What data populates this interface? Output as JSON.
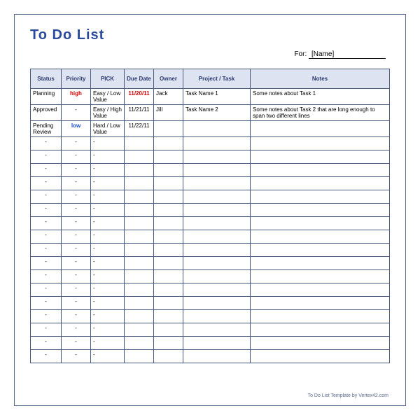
{
  "title": "To Do List",
  "for_label": "For:",
  "for_name": "[Name]",
  "headers": {
    "status": "Status",
    "priority": "Priority",
    "pick": "PICK",
    "due": "Due Date",
    "owner": "Owner",
    "task": "Project / Task",
    "notes": "Notes"
  },
  "rows": [
    {
      "status": "Planning",
      "priority": "high",
      "priority_class": "priority-high",
      "pick": "Easy / Low Value",
      "due": "11/20/11",
      "due_class": "due-red",
      "owner": "Jack",
      "task": "Task Name 1",
      "notes": "Some notes about Task 1"
    },
    {
      "status": "Approved",
      "priority": "-",
      "priority_class": "center",
      "pick": "Easy / High Value",
      "due": "11/21/11",
      "due_class": "center",
      "owner": "Jill",
      "task": "Task Name 2",
      "notes": "Some notes about Task 2 that are long enough to span two different lines"
    },
    {
      "status": "Pending Review",
      "priority": "low",
      "priority_class": "priority-low",
      "pick": "Hard / Low Value",
      "due": "11/22/11",
      "due_class": "center",
      "owner": "",
      "task": "",
      "notes": ""
    },
    {
      "status": "-",
      "priority": "-",
      "priority_class": "center",
      "pick": "-",
      "due": "",
      "due_class": "",
      "owner": "",
      "task": "",
      "notes": ""
    },
    {
      "status": "-",
      "priority": "-",
      "priority_class": "center",
      "pick": "-",
      "due": "",
      "due_class": "",
      "owner": "",
      "task": "",
      "notes": ""
    },
    {
      "status": "-",
      "priority": "-",
      "priority_class": "center",
      "pick": "-",
      "due": "",
      "due_class": "",
      "owner": "",
      "task": "",
      "notes": ""
    },
    {
      "status": "-",
      "priority": "-",
      "priority_class": "center",
      "pick": "-",
      "due": "",
      "due_class": "",
      "owner": "",
      "task": "",
      "notes": ""
    },
    {
      "status": "-",
      "priority": "-",
      "priority_class": "center",
      "pick": "-",
      "due": "",
      "due_class": "",
      "owner": "",
      "task": "",
      "notes": ""
    },
    {
      "status": "-",
      "priority": "-",
      "priority_class": "center",
      "pick": "-",
      "due": "",
      "due_class": "",
      "owner": "",
      "task": "",
      "notes": ""
    },
    {
      "status": "-",
      "priority": "-",
      "priority_class": "center",
      "pick": "-",
      "due": "",
      "due_class": "",
      "owner": "",
      "task": "",
      "notes": ""
    },
    {
      "status": "-",
      "priority": "-",
      "priority_class": "center",
      "pick": "-",
      "due": "",
      "due_class": "",
      "owner": "",
      "task": "",
      "notes": ""
    },
    {
      "status": "-",
      "priority": "-",
      "priority_class": "center",
      "pick": "-",
      "due": "",
      "due_class": "",
      "owner": "",
      "task": "",
      "notes": ""
    },
    {
      "status": "-",
      "priority": "-",
      "priority_class": "center",
      "pick": "-",
      "due": "",
      "due_class": "",
      "owner": "",
      "task": "",
      "notes": ""
    },
    {
      "status": "-",
      "priority": "-",
      "priority_class": "center",
      "pick": "-",
      "due": "",
      "due_class": "",
      "owner": "",
      "task": "",
      "notes": ""
    },
    {
      "status": "-",
      "priority": "-",
      "priority_class": "center",
      "pick": "-",
      "due": "",
      "due_class": "",
      "owner": "",
      "task": "",
      "notes": ""
    },
    {
      "status": "-",
      "priority": "-",
      "priority_class": "center",
      "pick": "-",
      "due": "",
      "due_class": "",
      "owner": "",
      "task": "",
      "notes": ""
    },
    {
      "status": "-",
      "priority": "-",
      "priority_class": "center",
      "pick": "-",
      "due": "",
      "due_class": "",
      "owner": "",
      "task": "",
      "notes": ""
    },
    {
      "status": "-",
      "priority": "-",
      "priority_class": "center",
      "pick": "-",
      "due": "",
      "due_class": "",
      "owner": "",
      "task": "",
      "notes": ""
    },
    {
      "status": "-",
      "priority": "-",
      "priority_class": "center",
      "pick": "-",
      "due": "",
      "due_class": "",
      "owner": "",
      "task": "",
      "notes": ""
    },
    {
      "status": "-",
      "priority": "-",
      "priority_class": "center",
      "pick": "-",
      "due": "",
      "due_class": "",
      "owner": "",
      "task": "",
      "notes": ""
    }
  ],
  "footer": "To Do List Template by Vertex42.com"
}
